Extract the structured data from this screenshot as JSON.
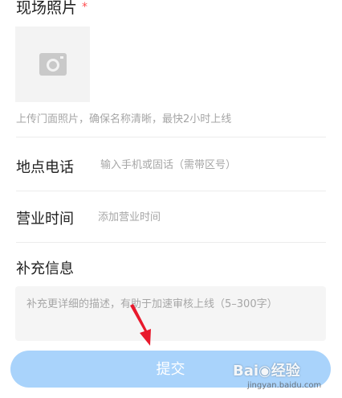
{
  "photo_section": {
    "title": "现场照片",
    "required_mark": "*",
    "hint": "上传门面照片，确保名称清晰，最快2小时上线"
  },
  "phone_row": {
    "label": "地点电话",
    "placeholder": "输入手机或固话（需带区号）"
  },
  "hours_row": {
    "label": "营业时间",
    "placeholder": "添加营业时间"
  },
  "description": {
    "title": "补充信息",
    "placeholder": "补充更详细的描述，有助于加速审核上线（5–300字）"
  },
  "submit": {
    "label": "提交"
  },
  "watermark": {
    "logo": "Bai◉经验",
    "url": "jingyan.baidu.com"
  },
  "colors": {
    "submit_bg": "#a9d3fb",
    "required": "#ff4d4f",
    "hint": "#a6a6a6",
    "arrow": "#e8192c"
  }
}
